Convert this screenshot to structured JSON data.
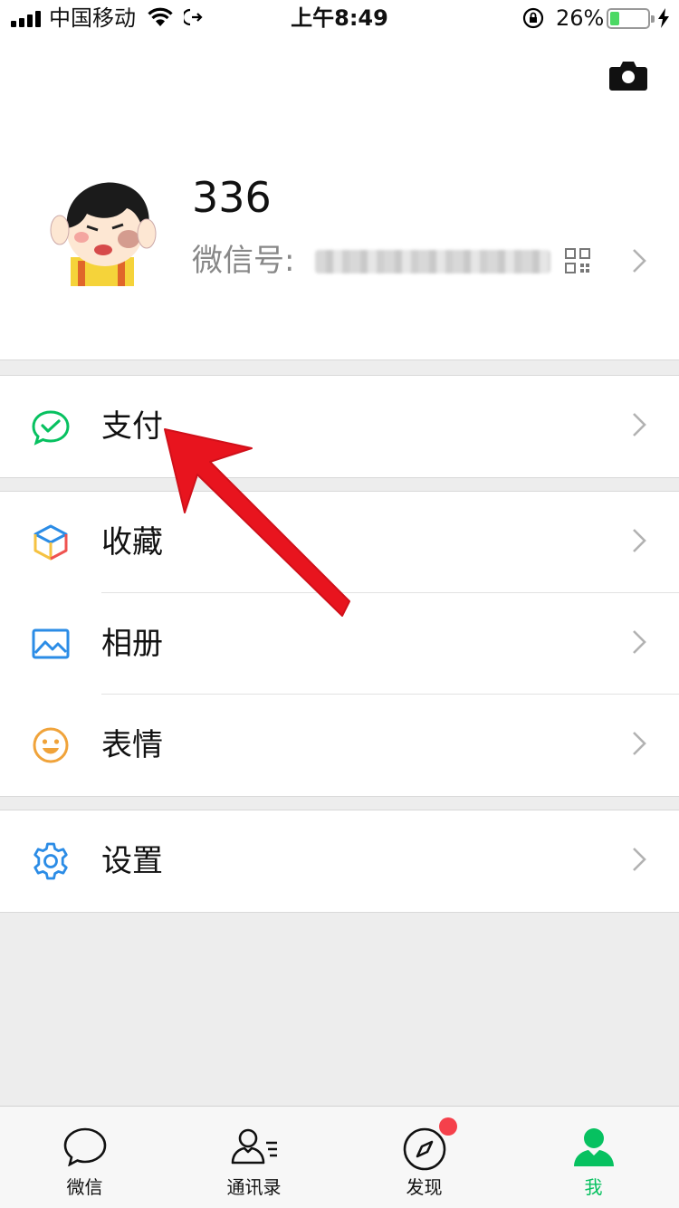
{
  "status_bar": {
    "carrier": "中国移动",
    "time": "上午8:49",
    "battery_percent": "26%",
    "battery_level": 0.26,
    "battery_color": "#4cd964"
  },
  "profile": {
    "name": "336",
    "wechat_id_label": "微信号:",
    "wechat_id_value": "",
    "camera_icon": "camera-icon",
    "qr_icon": "qr-code-icon"
  },
  "menu": {
    "pay": {
      "label": "支付",
      "icon": "wechat-pay-icon"
    },
    "favorites": {
      "label": "收藏",
      "icon": "cube-icon"
    },
    "album": {
      "label": "相册",
      "icon": "image-icon"
    },
    "stickers": {
      "label": "表情",
      "icon": "smiley-icon"
    },
    "settings": {
      "label": "设置",
      "icon": "gear-icon"
    }
  },
  "tab_bar": {
    "tabs": [
      {
        "label": "微信",
        "icon": "chat-bubble-icon",
        "active": false
      },
      {
        "label": "通讯录",
        "icon": "contacts-icon",
        "active": false
      },
      {
        "label": "发现",
        "icon": "compass-icon",
        "active": false,
        "badge": true
      },
      {
        "label": "我",
        "icon": "person-icon",
        "active": true
      }
    ]
  },
  "colors": {
    "accent_green": "#07c160",
    "badge_red": "#f5404b",
    "annotation_arrow": "#e8141e"
  }
}
